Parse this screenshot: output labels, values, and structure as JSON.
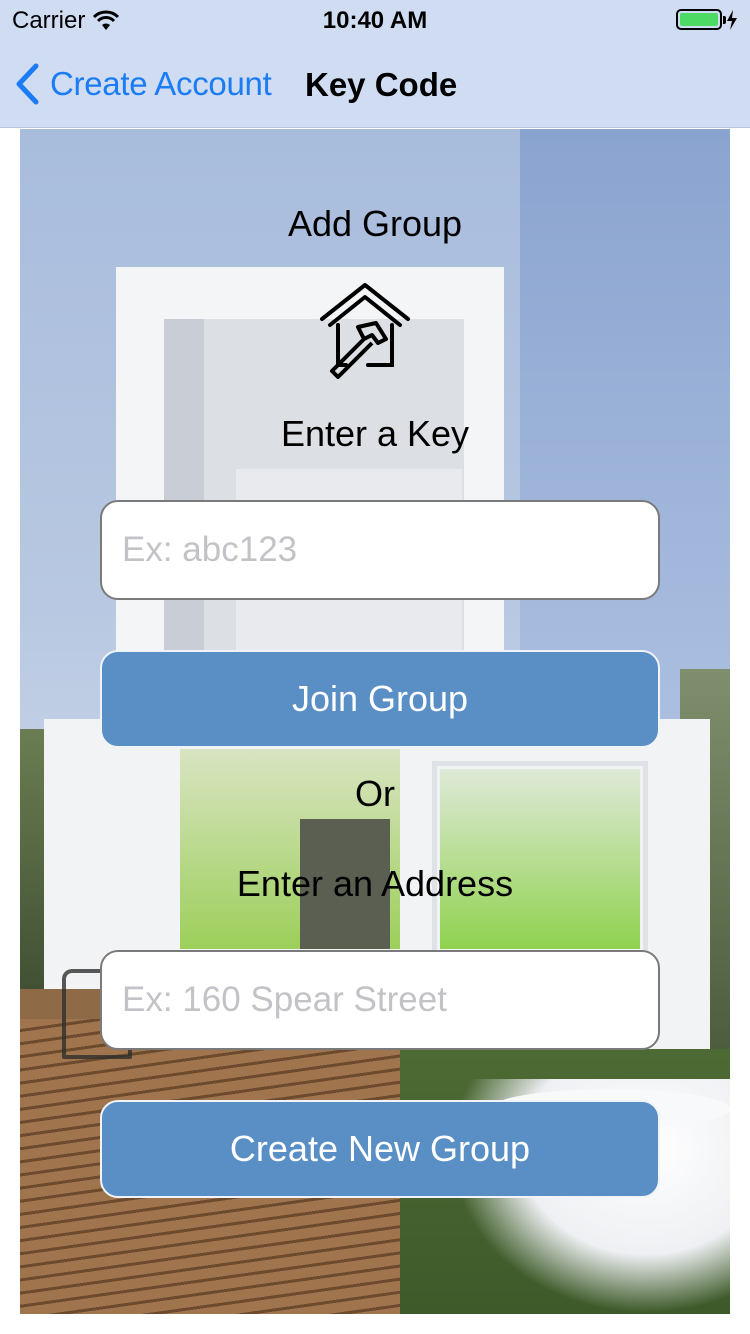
{
  "status_bar": {
    "carrier": "Carrier",
    "time": "10:40 AM",
    "battery_level": 1.0,
    "battery_color": "#4cd964"
  },
  "nav_bar": {
    "back_label": "Create Account",
    "title": "Key Code",
    "back_icon": "chevron-left-icon",
    "accent_color": "#1c7cf4"
  },
  "main": {
    "heading": "Add Group",
    "icon": "house-hammer-icon",
    "key_label": "Enter a Key",
    "key_input": {
      "value": "",
      "placeholder": "Ex: abc123"
    },
    "join_button": "Join Group",
    "or_label": "Or",
    "address_label": "Enter an Address",
    "address_input": {
      "value": "",
      "placeholder": "Ex: 160 Spear Street"
    },
    "create_button": "Create New Group",
    "button_color": "#5a8fc6"
  }
}
